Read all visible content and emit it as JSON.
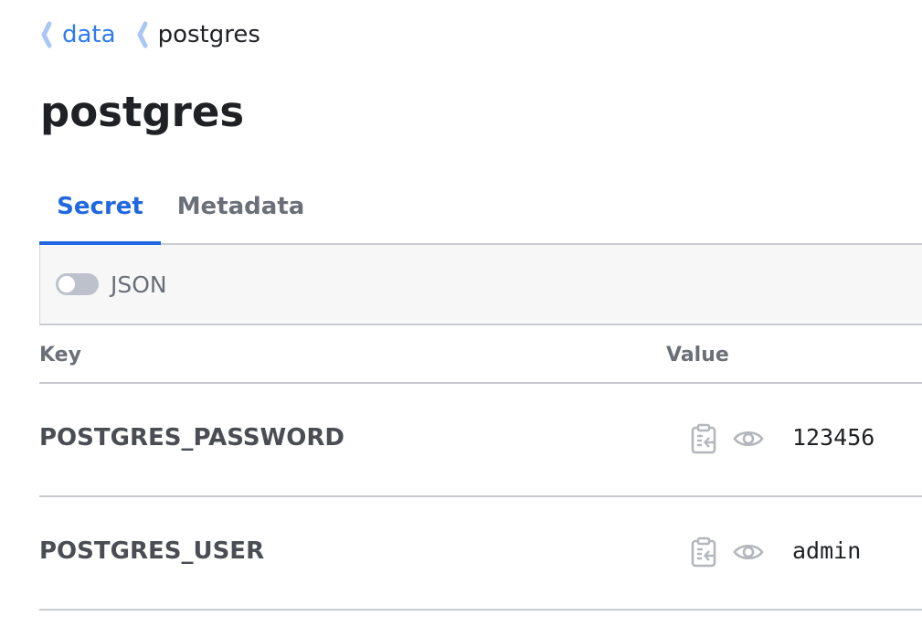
{
  "breadcrumb": {
    "items": [
      {
        "label": "data"
      },
      {
        "label": "postgres"
      }
    ]
  },
  "page": {
    "title": "postgres"
  },
  "tabs": [
    {
      "label": "Secret",
      "active": true
    },
    {
      "label": "Metadata",
      "active": false
    }
  ],
  "toolbar": {
    "json_toggle_label": "JSON",
    "json_toggle_on": false
  },
  "table": {
    "columns": {
      "key": "Key",
      "value": "Value"
    },
    "rows": [
      {
        "key": "POSTGRES_PASSWORD",
        "value": "123456"
      },
      {
        "key": "POSTGRES_USER",
        "value": "admin"
      }
    ]
  },
  "icons": {
    "breadcrumb_separator": "chevron-left-icon",
    "copy": "clipboard-icon",
    "reveal": "eye-icon"
  },
  "colors": {
    "accent": "#2168e0",
    "link": "#2f7bf0",
    "toggle_off": "#bcc1cc"
  }
}
